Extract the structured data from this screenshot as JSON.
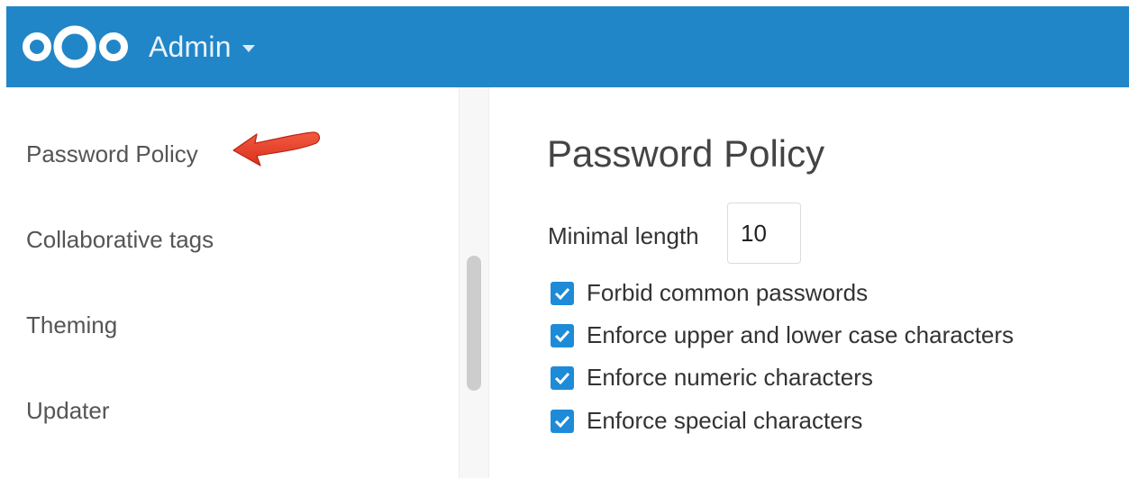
{
  "header": {
    "app_title": "Admin",
    "background_color": "#2186c8",
    "logo_icon": "nextcloud-logo-icon",
    "caret_icon": "chevron-down-icon"
  },
  "sidebar": {
    "items": [
      {
        "label": "Password Policy",
        "active": true
      },
      {
        "label": "Collaborative tags"
      },
      {
        "label": "Theming"
      },
      {
        "label": "Updater"
      }
    ],
    "annotation_icon": "red-arrow-pointer-icon"
  },
  "main": {
    "title": "Password Policy",
    "minimal_length": {
      "label": "Minimal length",
      "value": "10"
    },
    "options": [
      {
        "label": "Forbid common passwords",
        "checked": true
      },
      {
        "label": "Enforce upper and lower case characters",
        "checked": true
      },
      {
        "label": "Enforce numeric characters",
        "checked": true
      },
      {
        "label": "Enforce special characters",
        "checked": true
      }
    ],
    "checkbox_color": "#1e8bd8"
  }
}
